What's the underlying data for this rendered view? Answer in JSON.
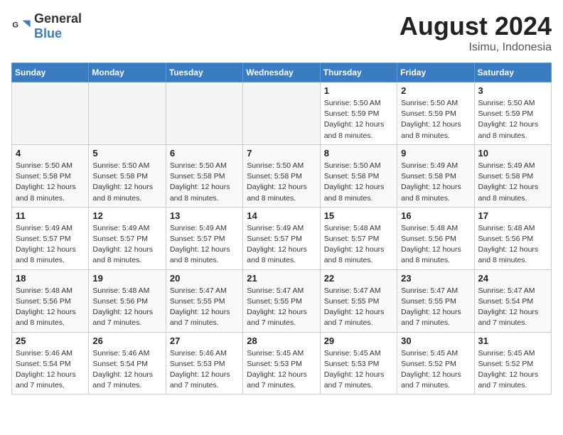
{
  "header": {
    "logo_general": "General",
    "logo_blue": "Blue",
    "month_title": "August 2024",
    "location": "Isimu, Indonesia"
  },
  "days_of_week": [
    "Sunday",
    "Monday",
    "Tuesday",
    "Wednesday",
    "Thursday",
    "Friday",
    "Saturday"
  ],
  "weeks": [
    [
      {
        "day": "",
        "info": ""
      },
      {
        "day": "",
        "info": ""
      },
      {
        "day": "",
        "info": ""
      },
      {
        "day": "",
        "info": ""
      },
      {
        "day": "1",
        "info": "Sunrise: 5:50 AM\nSunset: 5:59 PM\nDaylight: 12 hours\nand 8 minutes."
      },
      {
        "day": "2",
        "info": "Sunrise: 5:50 AM\nSunset: 5:59 PM\nDaylight: 12 hours\nand 8 minutes."
      },
      {
        "day": "3",
        "info": "Sunrise: 5:50 AM\nSunset: 5:59 PM\nDaylight: 12 hours\nand 8 minutes."
      }
    ],
    [
      {
        "day": "4",
        "info": "Sunrise: 5:50 AM\nSunset: 5:58 PM\nDaylight: 12 hours\nand 8 minutes."
      },
      {
        "day": "5",
        "info": "Sunrise: 5:50 AM\nSunset: 5:58 PM\nDaylight: 12 hours\nand 8 minutes."
      },
      {
        "day": "6",
        "info": "Sunrise: 5:50 AM\nSunset: 5:58 PM\nDaylight: 12 hours\nand 8 minutes."
      },
      {
        "day": "7",
        "info": "Sunrise: 5:50 AM\nSunset: 5:58 PM\nDaylight: 12 hours\nand 8 minutes."
      },
      {
        "day": "8",
        "info": "Sunrise: 5:50 AM\nSunset: 5:58 PM\nDaylight: 12 hours\nand 8 minutes."
      },
      {
        "day": "9",
        "info": "Sunrise: 5:49 AM\nSunset: 5:58 PM\nDaylight: 12 hours\nand 8 minutes."
      },
      {
        "day": "10",
        "info": "Sunrise: 5:49 AM\nSunset: 5:58 PM\nDaylight: 12 hours\nand 8 minutes."
      }
    ],
    [
      {
        "day": "11",
        "info": "Sunrise: 5:49 AM\nSunset: 5:57 PM\nDaylight: 12 hours\nand 8 minutes."
      },
      {
        "day": "12",
        "info": "Sunrise: 5:49 AM\nSunset: 5:57 PM\nDaylight: 12 hours\nand 8 minutes."
      },
      {
        "day": "13",
        "info": "Sunrise: 5:49 AM\nSunset: 5:57 PM\nDaylight: 12 hours\nand 8 minutes."
      },
      {
        "day": "14",
        "info": "Sunrise: 5:49 AM\nSunset: 5:57 PM\nDaylight: 12 hours\nand 8 minutes."
      },
      {
        "day": "15",
        "info": "Sunrise: 5:48 AM\nSunset: 5:57 PM\nDaylight: 12 hours\nand 8 minutes."
      },
      {
        "day": "16",
        "info": "Sunrise: 5:48 AM\nSunset: 5:56 PM\nDaylight: 12 hours\nand 8 minutes."
      },
      {
        "day": "17",
        "info": "Sunrise: 5:48 AM\nSunset: 5:56 PM\nDaylight: 12 hours\nand 8 minutes."
      }
    ],
    [
      {
        "day": "18",
        "info": "Sunrise: 5:48 AM\nSunset: 5:56 PM\nDaylight: 12 hours\nand 8 minutes."
      },
      {
        "day": "19",
        "info": "Sunrise: 5:48 AM\nSunset: 5:56 PM\nDaylight: 12 hours\nand 7 minutes."
      },
      {
        "day": "20",
        "info": "Sunrise: 5:47 AM\nSunset: 5:55 PM\nDaylight: 12 hours\nand 7 minutes."
      },
      {
        "day": "21",
        "info": "Sunrise: 5:47 AM\nSunset: 5:55 PM\nDaylight: 12 hours\nand 7 minutes."
      },
      {
        "day": "22",
        "info": "Sunrise: 5:47 AM\nSunset: 5:55 PM\nDaylight: 12 hours\nand 7 minutes."
      },
      {
        "day": "23",
        "info": "Sunrise: 5:47 AM\nSunset: 5:55 PM\nDaylight: 12 hours\nand 7 minutes."
      },
      {
        "day": "24",
        "info": "Sunrise: 5:47 AM\nSunset: 5:54 PM\nDaylight: 12 hours\nand 7 minutes."
      }
    ],
    [
      {
        "day": "25",
        "info": "Sunrise: 5:46 AM\nSunset: 5:54 PM\nDaylight: 12 hours\nand 7 minutes."
      },
      {
        "day": "26",
        "info": "Sunrise: 5:46 AM\nSunset: 5:54 PM\nDaylight: 12 hours\nand 7 minutes."
      },
      {
        "day": "27",
        "info": "Sunrise: 5:46 AM\nSunset: 5:53 PM\nDaylight: 12 hours\nand 7 minutes."
      },
      {
        "day": "28",
        "info": "Sunrise: 5:45 AM\nSunset: 5:53 PM\nDaylight: 12 hours\nand 7 minutes."
      },
      {
        "day": "29",
        "info": "Sunrise: 5:45 AM\nSunset: 5:53 PM\nDaylight: 12 hours\nand 7 minutes."
      },
      {
        "day": "30",
        "info": "Sunrise: 5:45 AM\nSunset: 5:52 PM\nDaylight: 12 hours\nand 7 minutes."
      },
      {
        "day": "31",
        "info": "Sunrise: 5:45 AM\nSunset: 5:52 PM\nDaylight: 12 hours\nand 7 minutes."
      }
    ]
  ]
}
